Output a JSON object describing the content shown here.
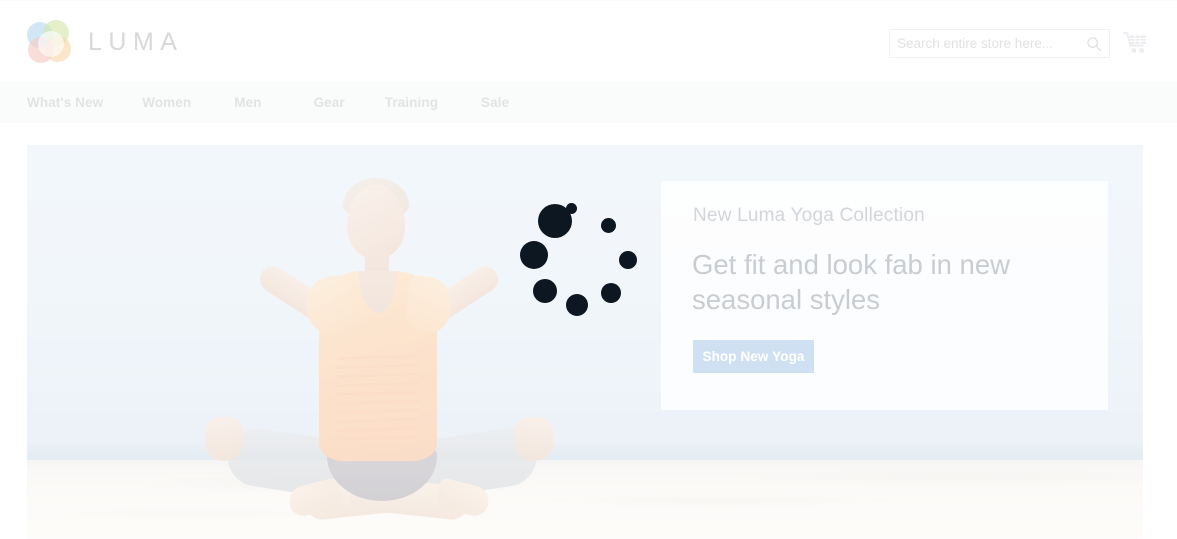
{
  "site": {
    "brand_name": "LUMA",
    "logo_icon": "luma-flower-logo-icon",
    "accent_color": "#cfe0f2",
    "hero_sky_color": "#dce7f2",
    "text_muted_color": "#d8d8d8"
  },
  "header": {
    "search": {
      "placeholder": "Search entire store here...",
      "value": "",
      "icon": "search-icon"
    },
    "cart": {
      "icon": "shopping-cart-icon",
      "label": "My Cart",
      "count": ""
    }
  },
  "nav": {
    "items": [
      {
        "label": "What's New"
      },
      {
        "label": "Women"
      },
      {
        "label": "Men"
      },
      {
        "label": "Gear"
      },
      {
        "label": "Training"
      },
      {
        "label": "Sale"
      }
    ]
  },
  "hero": {
    "image_alt": "Woman meditating in lotus pose on a beach",
    "promo": {
      "eyebrow": "New Luma Yoga Collection",
      "headline": "Get fit and look fab in new seasonal styles",
      "cta_label": "Shop New Yoga"
    }
  },
  "loading": {
    "state": "loading",
    "spinner_icon": "loading-spinner-dots-icon",
    "dot_color": "#0c1722",
    "dot_count": 8
  }
}
